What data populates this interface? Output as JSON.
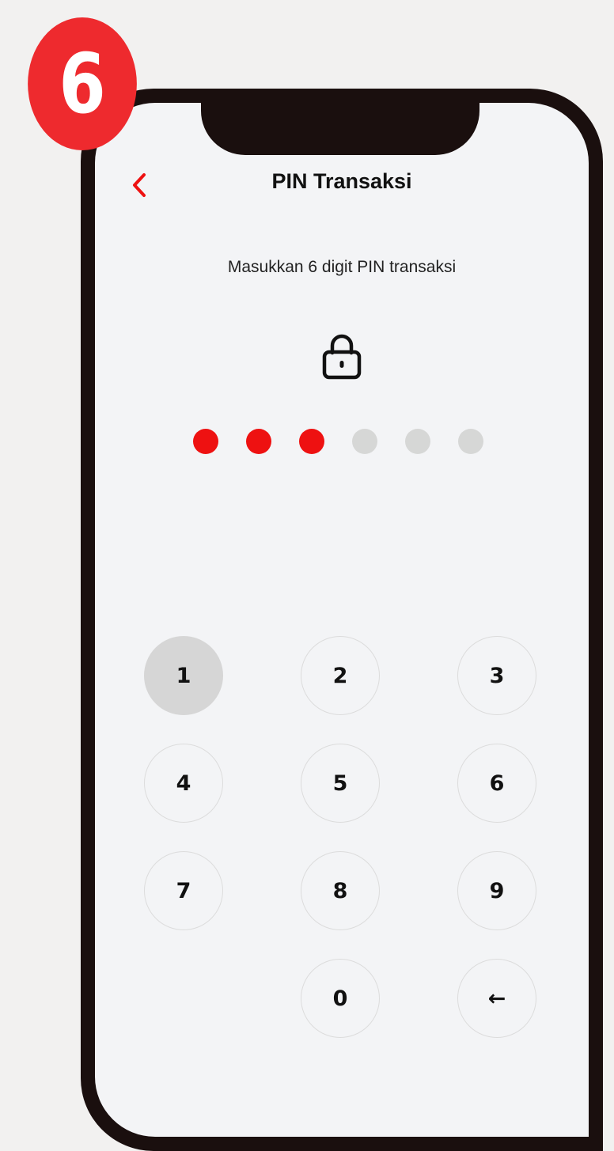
{
  "step_badge": "6",
  "header": {
    "title": "PIN Transaksi",
    "back_icon": "chevron-left-icon"
  },
  "prompt": "Masukkan 6 digit PIN transaksi",
  "lock_icon": "lock-icon",
  "pin": {
    "length": 6,
    "entered": 3,
    "filled_color": "#ee1111",
    "empty_color": "#d6d7d6"
  },
  "keypad": {
    "keys": [
      "1",
      "2",
      "3",
      "4",
      "5",
      "6",
      "7",
      "8",
      "9",
      "0",
      "←"
    ],
    "pressed_key": "1"
  },
  "colors": {
    "accent": "#ee2a2e",
    "screen_bg": "#f3f4f6",
    "frame": "#1a0f0e"
  }
}
